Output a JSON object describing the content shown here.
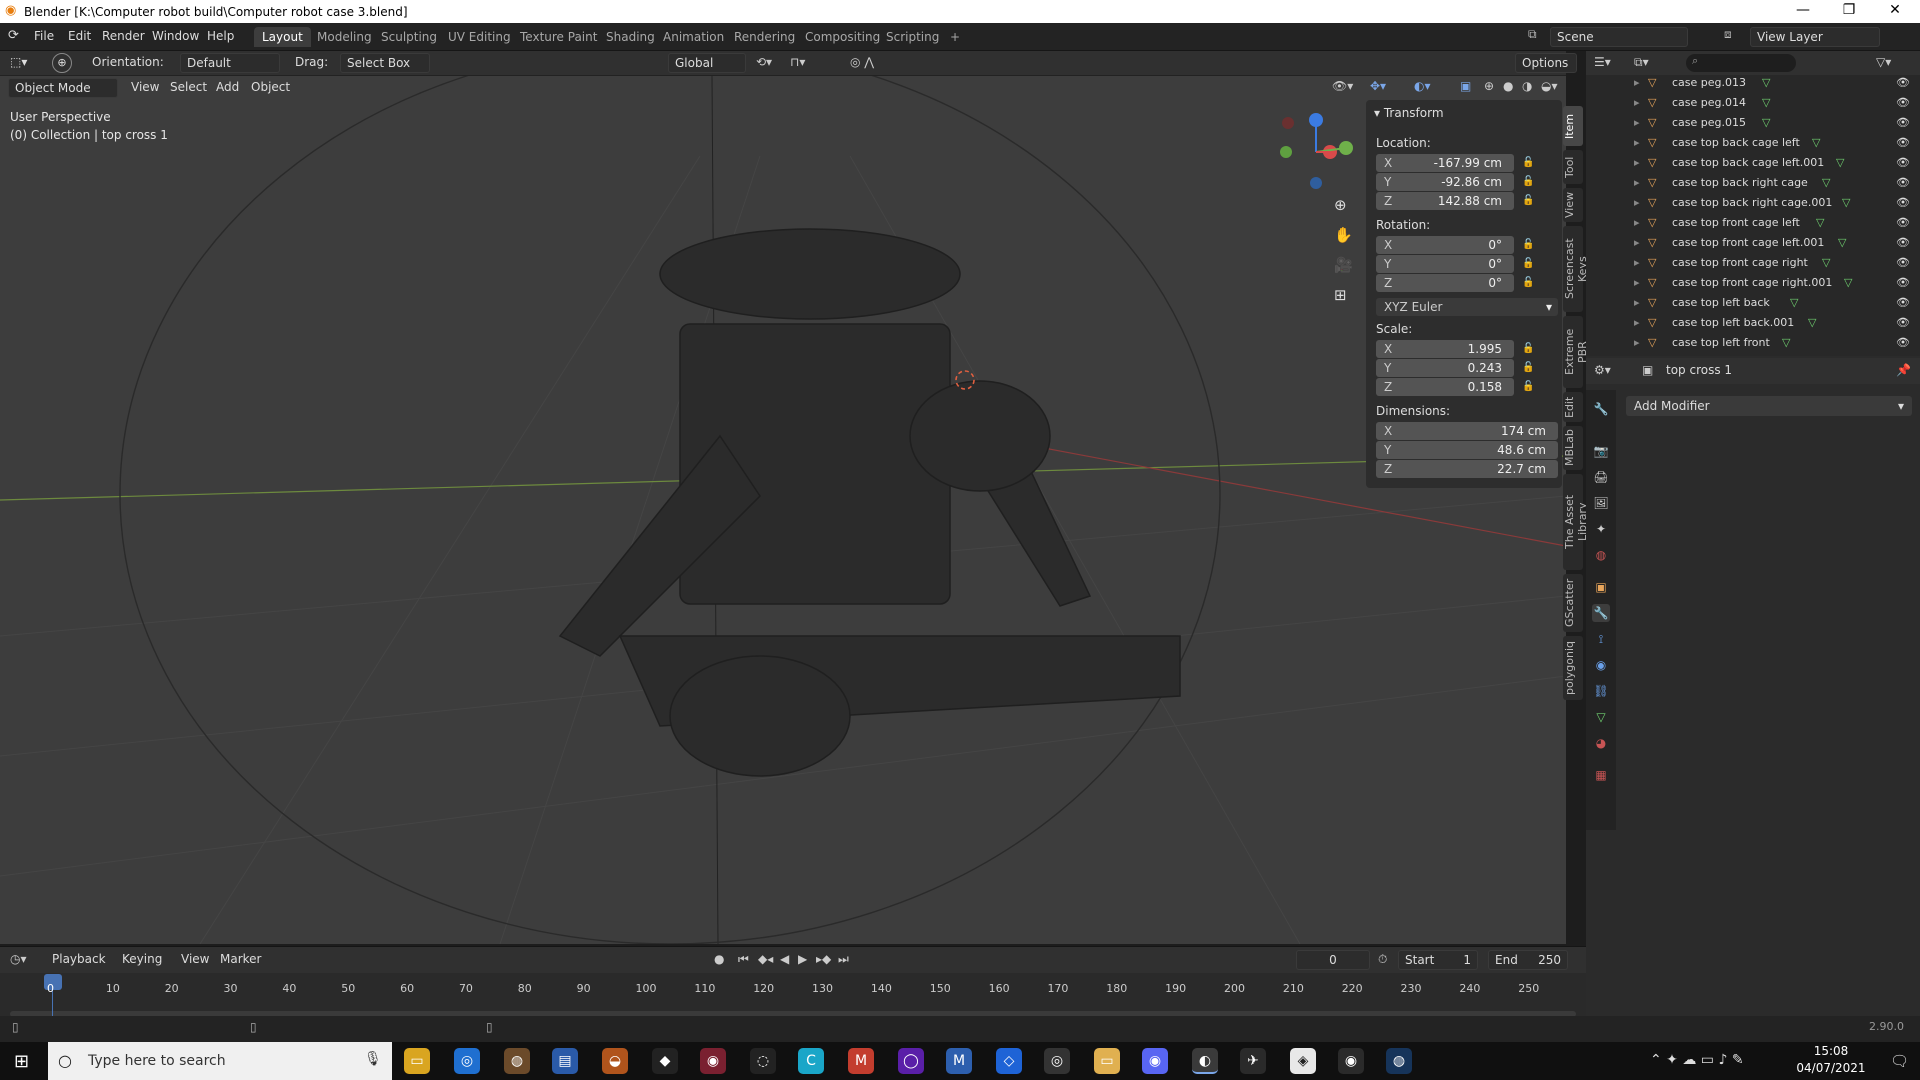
{
  "window": {
    "title": "Blender [K:\\Computer robot build\\Computer robot case 3.blend]",
    "min": "—",
    "max": "❐",
    "close": "✕"
  },
  "menu": [
    "File",
    "Edit",
    "Render",
    "Window",
    "Help"
  ],
  "workspaces": [
    "Layout",
    "Modeling",
    "Sculpting",
    "UV Editing",
    "Texture Paint",
    "Shading",
    "Animation",
    "Rendering",
    "Compositing",
    "Scripting",
    "+"
  ],
  "scene": {
    "label": "Scene",
    "view_layer": "View Layer"
  },
  "header": {
    "orientation_label": "Orientation:",
    "orientation_value": "Default",
    "drag_label": "Drag:",
    "drag_value": "Select Box",
    "transform_value": "Global",
    "options": "Options"
  },
  "viewport_header": {
    "mode": "Object Mode",
    "items": [
      "View",
      "Select",
      "Add",
      "Object"
    ]
  },
  "viewport": {
    "perspective": "User Perspective",
    "collection": "(0) Collection | top cross 1"
  },
  "npanel": {
    "title": "Transform",
    "location_label": "Location:",
    "location": [
      {
        "axis": "X",
        "value": "-167.99 cm"
      },
      {
        "axis": "Y",
        "value": "-92.86 cm"
      },
      {
        "axis": "Z",
        "value": "142.88 cm"
      }
    ],
    "rotation_label": "Rotation:",
    "rotation": [
      {
        "axis": "X",
        "value": "0°"
      },
      {
        "axis": "Y",
        "value": "0°"
      },
      {
        "axis": "Z",
        "value": "0°"
      }
    ],
    "rotation_mode": "XYZ Euler",
    "scale_label": "Scale:",
    "scale": [
      {
        "axis": "X",
        "value": "1.995"
      },
      {
        "axis": "Y",
        "value": "0.243"
      },
      {
        "axis": "Z",
        "value": "0.158"
      }
    ],
    "dimensions_label": "Dimensions:",
    "dimensions": [
      {
        "axis": "X",
        "value": "174 cm"
      },
      {
        "axis": "Y",
        "value": "48.6 cm"
      },
      {
        "axis": "Z",
        "value": "22.7 cm"
      }
    ]
  },
  "side_tabs": [
    "Item",
    "Tool",
    "View",
    "Screencast Keys",
    "Extreme PBR",
    "Edit",
    "MBLab",
    "The Asset Library",
    "GScatter",
    "polygoniq"
  ],
  "outliner": {
    "items": [
      "case peg.013",
      "case peg.014",
      "case peg.015",
      "case top back cage left",
      "case top back cage left.001",
      "case top back right cage",
      "case top back right cage.001",
      "case top front cage left",
      "case top front cage left.001",
      "case top front cage right",
      "case top front cage right.001",
      "case top left back",
      "case top left back.001",
      "case top left front"
    ]
  },
  "properties": {
    "object": "top cross 1",
    "add_modifier": "Add Modifier"
  },
  "timeline": {
    "menus": [
      "Playback",
      "Keying",
      "View",
      "Marker"
    ],
    "current_frame": "0",
    "start_label": "Start",
    "start": "1",
    "end_label": "End",
    "end": "250",
    "ticks": [
      "0",
      "10",
      "20",
      "30",
      "40",
      "50",
      "60",
      "70",
      "80",
      "90",
      "100",
      "110",
      "120",
      "130",
      "140",
      "150",
      "160",
      "170",
      "180",
      "190",
      "200",
      "210",
      "220",
      "230",
      "240",
      "250"
    ]
  },
  "status": {
    "version": "2.90.0"
  },
  "taskbar": {
    "search_placeholder": "Type here to search",
    "time": "15:08",
    "date": "04/07/2021"
  },
  "colors": {
    "viewport_bg": "#3d3d3d",
    "accent": "#4772b3",
    "outliner_icon": "#e8a55b",
    "mesh_icon": "#6fcf6f"
  }
}
